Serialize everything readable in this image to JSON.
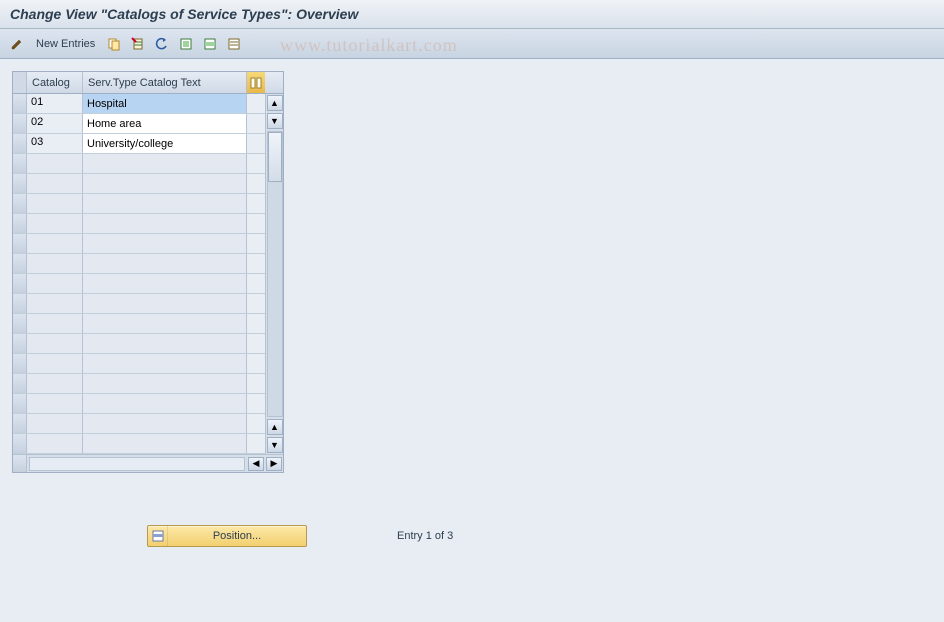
{
  "title": "Change View \"Catalogs of Service Types\": Overview",
  "toolbar": {
    "new_entries_label": "New Entries"
  },
  "watermark": "www.tutorialkart.com",
  "grid": {
    "columns": {
      "catalog": "Catalog",
      "text": "Serv.Type Catalog Text"
    },
    "rows": [
      {
        "catalog": "01",
        "text": "Hospital",
        "selected": true
      },
      {
        "catalog": "02",
        "text": "Home area",
        "selected": false
      },
      {
        "catalog": "03",
        "text": "University/college",
        "selected": false
      }
    ],
    "empty_rows": 15
  },
  "footer": {
    "position_label": "Position...",
    "entry_status": "Entry 1 of 3"
  }
}
